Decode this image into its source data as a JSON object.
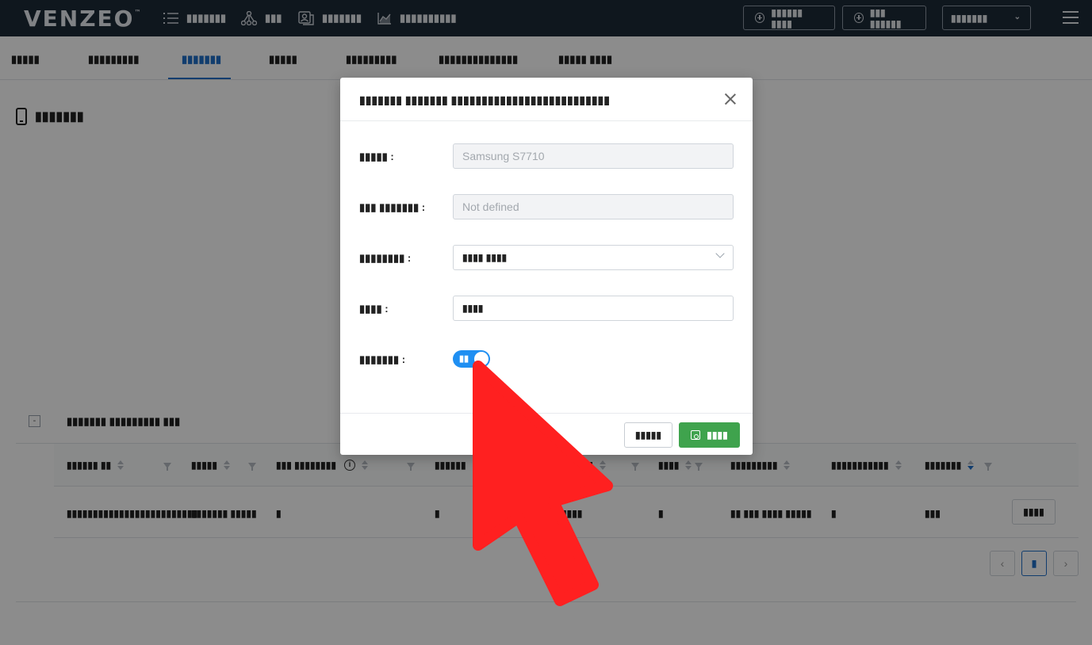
{
  "app": {
    "logo": "VENZEO",
    "logo_mark": "™"
  },
  "topnav": {
    "items": [
      {
        "label": "▮▮▮▮▮▮▮",
        "icon": "list-icon"
      },
      {
        "label": "▮▮▮",
        "icon": "tree-icon"
      },
      {
        "label": "▮▮▮▮▮▮▮",
        "icon": "profile-card-icon"
      },
      {
        "label": "▮▮▮▮▮▮▮▮▮▮",
        "icon": "area-chart-icon"
      }
    ],
    "buttons": [
      {
        "label": "▮▮▮▮▮▮ ▮▮▮▮"
      },
      {
        "label": "▮▮▮ ▮▮▮▮▮▮"
      }
    ],
    "language_select": "▮▮▮▮▮▮▮"
  },
  "tabs": [
    {
      "label": "▮▮▮▮▮",
      "active": false
    },
    {
      "label": "▮▮▮▮▮▮▮▮▮",
      "active": false
    },
    {
      "label": "▮▮▮▮▮▮▮",
      "active": true
    },
    {
      "label": "▮▮▮▮▮",
      "active": false
    },
    {
      "label": "▮▮▮▮▮▮▮▮▮",
      "active": false
    },
    {
      "label": "▮▮▮▮▮▮▮▮▮▮▮▮▮▮",
      "active": false
    },
    {
      "label": "▮▮▮▮▮ ▮▮▮▮",
      "active": false
    }
  ],
  "section": {
    "title": "▮▮▮▮▮▮▮"
  },
  "group": {
    "collapse_symbol": "-",
    "title": "▮▮▮▮▮▮▮ ▮▮▮▮▮▮▮▮▮ ▮▮▮"
  },
  "table": {
    "columns": [
      "▮▮▮▮▮▮ ▮▮",
      "▮▮▮▮▮",
      "▮▮▮ ▮▮▮▮▮▮▮▮",
      "▮▮▮▮▮▮",
      "▮▮▮",
      "▮▮▮▮",
      "▮▮▮▮▮▮▮▮▮",
      "▮▮▮▮▮▮▮▮▮▮▮",
      "▮▮▮▮▮▮▮"
    ],
    "info_symbol": "i",
    "rows": [
      {
        "cells": [
          "▮▮▮▮▮▮▮▮▮▮▮▮▮▮▮▮▮▮▮▮▮▮▮▮▮",
          "▮▮▮▮▮▮▮ ▮▮▮▮▮",
          "▮",
          "▮",
          "▮▮▮▮",
          "▮",
          "▮▮ ▮▮▮ ▮▮▮▮ ▮▮▮▮▮",
          "▮",
          "▮▮▮"
        ],
        "action_label": "▮▮▮▮"
      }
    ]
  },
  "pagination": {
    "prev": "‹",
    "current": "▮",
    "next": "›"
  },
  "modal": {
    "title": "▮▮▮▮▮▮▮ ▮▮▮▮▮▮▮ ▮▮▮▮▮▮▮▮▮▮▮▮▮▮▮▮▮▮▮▮▮▮▮▮▮▮",
    "fields": [
      {
        "label": "▮▮▮▮▮ :",
        "value": "Samsung S7710",
        "disabled": true
      },
      {
        "label": "▮▮▮ ▮▮▮▮▮▮▮ :",
        "value": "Not defined",
        "disabled": true
      },
      {
        "label": "▮▮▮▮▮▮▮▮ :",
        "value": "▮▮▮▮ ▮▮▮▮",
        "type": "select"
      },
      {
        "label": "▮▮▮▮ :",
        "value": "▮▮▮▮"
      },
      {
        "label": "▮▮▮▮▮▮▮ :",
        "type": "switch",
        "switch_text": "▮▮",
        "on": true
      }
    ],
    "cancel_label": "▮▮▮▮▮",
    "save_label": "▮▮▮▮",
    "colors": {
      "primary": "#1f8ff2",
      "success": "#3fa34d"
    }
  },
  "colors": {
    "topbar": "#1d2a38",
    "accent": "#1f6fc8",
    "annotation_arrow": "#ff2020"
  }
}
